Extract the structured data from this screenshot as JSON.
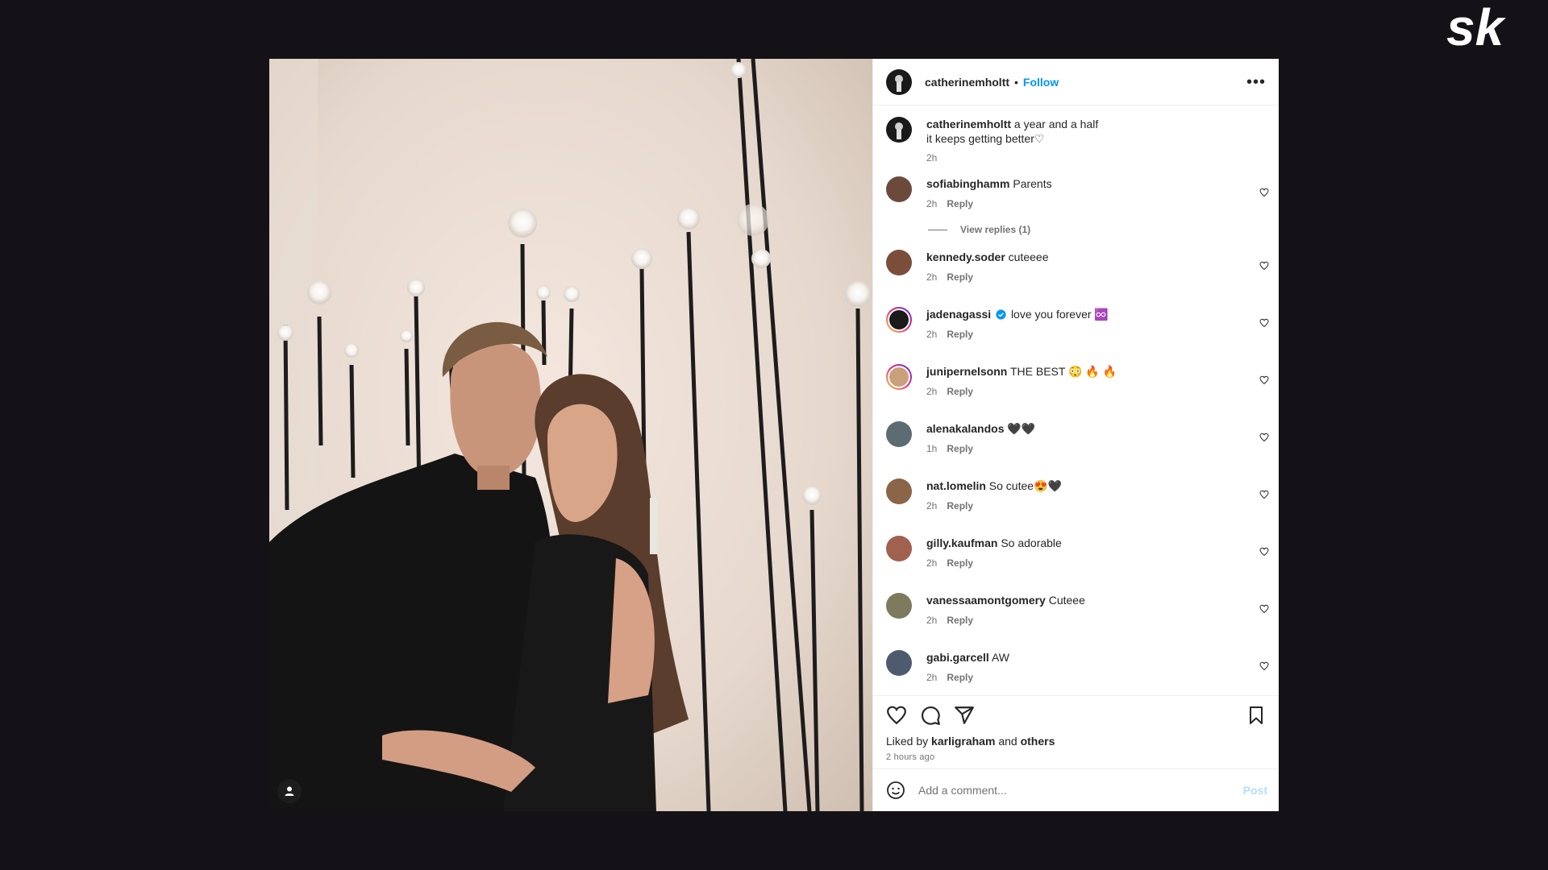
{
  "brand": {
    "logo_text": "sk"
  },
  "post": {
    "author": "catherinemholtt",
    "separator": "•",
    "follow_label": "Follow",
    "more_label": "•••",
    "caption_line1": "a year and a half",
    "caption_line2": "it keeps getting better♡",
    "caption_time": "2h"
  },
  "comments": [
    {
      "user": "sofiabinghamm",
      "text": "Parents",
      "time": "2h",
      "reply": "Reply",
      "view_replies": "View replies (1)",
      "avatar_color": "#6b4a3c"
    },
    {
      "user": "kennedy.soder",
      "text": "cuteeee",
      "time": "2h",
      "reply": "Reply",
      "avatar_color": "#7a4e3a"
    },
    {
      "user": "jadenagassi",
      "verified": true,
      "text": "love you forever ♾️",
      "time": "2h",
      "reply": "Reply",
      "avatar_color": "#1b1b1b",
      "story_ring": true
    },
    {
      "user": "junipernelsonn",
      "text": "THE BEST 😳 🔥 🔥",
      "time": "2h",
      "reply": "Reply",
      "avatar_color": "#c9a07a",
      "story_ring": true
    },
    {
      "user": "alenakalandos",
      "text": "🖤🖤",
      "time": "1h",
      "reply": "Reply",
      "avatar_color": "#5d6b73"
    },
    {
      "user": "nat.lomelin",
      "text": "So cutee😍🖤",
      "time": "2h",
      "reply": "Reply",
      "avatar_color": "#8a6547"
    },
    {
      "user": "gilly.kaufman",
      "text": "So adorable",
      "time": "2h",
      "reply": "Reply",
      "avatar_color": "#a0614f"
    },
    {
      "user": "vanessaamontgomery",
      "text": "Cuteee",
      "time": "2h",
      "reply": "Reply",
      "avatar_color": "#7d7a5e"
    },
    {
      "user": "gabi.garcell",
      "text": "AW",
      "time": "2h",
      "reply": "Reply",
      "avatar_color": "#4e5b6e"
    }
  ],
  "actions": {
    "liked_prefix": "Liked by",
    "liked_user": "karligraham",
    "liked_and": "and",
    "liked_others": "others",
    "time_ago": "2 hours ago"
  },
  "add_comment": {
    "placeholder": "Add a comment...",
    "post_label": "Post"
  },
  "colors": {
    "link": "#0095f6",
    "bg": "#141217",
    "post_disabled": "#b2dffc"
  },
  "icons": [
    "heart-icon",
    "comment-icon",
    "share-icon",
    "bookmark-icon",
    "emoji-icon",
    "user-tag-icon",
    "more-icon"
  ]
}
